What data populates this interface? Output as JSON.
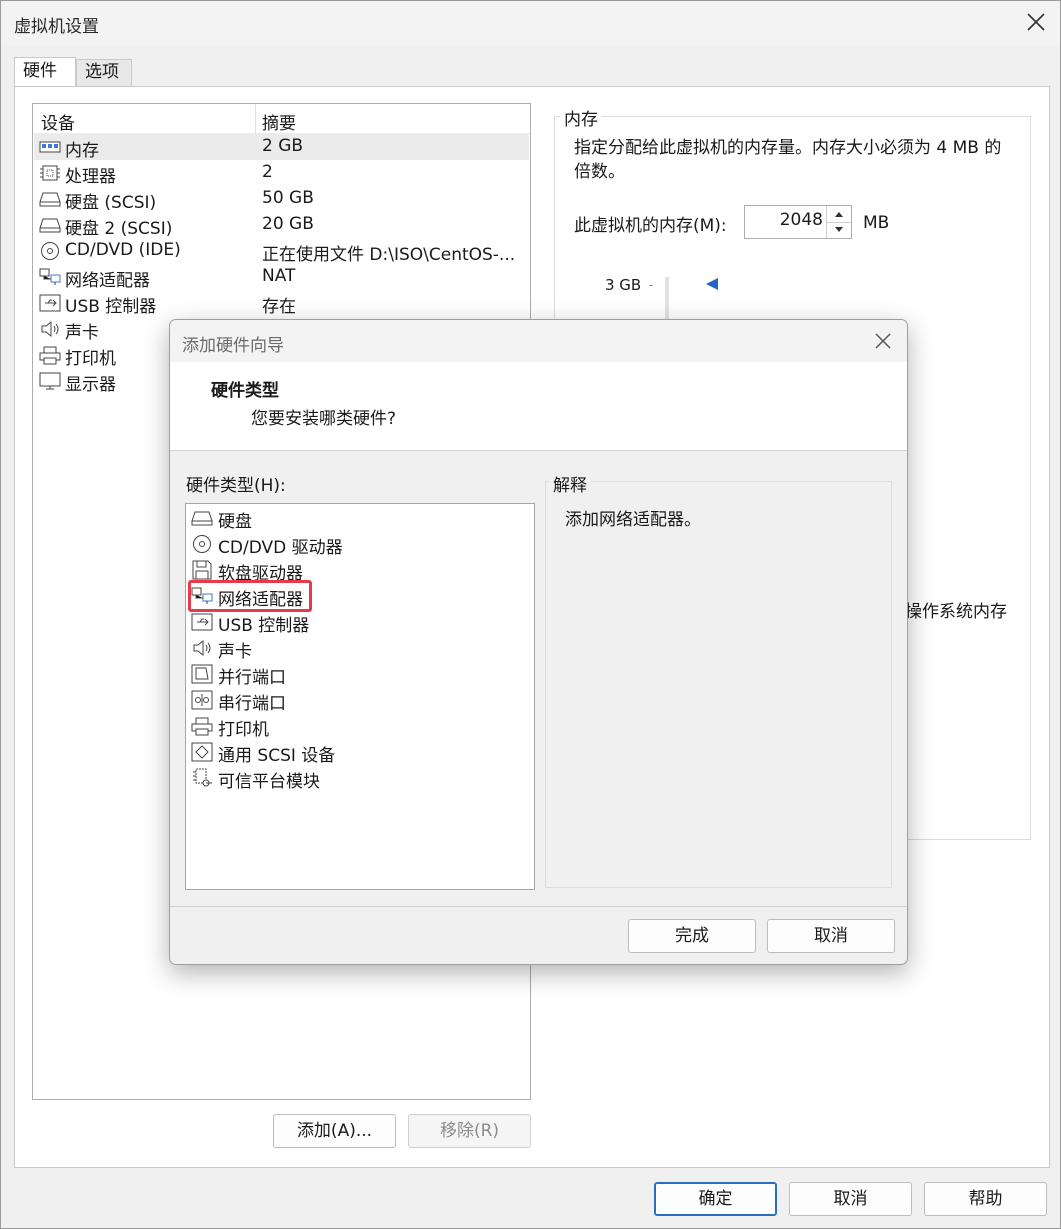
{
  "window": {
    "title": "虚拟机设置",
    "tabs": [
      {
        "label": "硬件"
      },
      {
        "label": "选项"
      }
    ],
    "device_list": {
      "columns": [
        "设备",
        "摘要"
      ],
      "rows": [
        {
          "name": "内存",
          "summary": "2 GB",
          "icon": "memory-icon"
        },
        {
          "name": "处理器",
          "summary": "2",
          "icon": "processor-icon"
        },
        {
          "name": "硬盘 (SCSI)",
          "summary": "50 GB",
          "icon": "hard-disk-icon"
        },
        {
          "name": "硬盘 2 (SCSI)",
          "summary": "20 GB",
          "icon": "hard-disk-icon"
        },
        {
          "name": "CD/DVD (IDE)",
          "summary": "正在使用文件 D:\\ISO\\CentOS-...",
          "icon": "cd-dvd-icon"
        },
        {
          "name": "网络适配器",
          "summary": "NAT",
          "icon": "network-adapter-icon"
        },
        {
          "name": "USB 控制器",
          "summary": "存在",
          "icon": "usb-icon"
        },
        {
          "name": "声卡",
          "summary": "",
          "icon": "speaker-icon"
        },
        {
          "name": "打印机",
          "summary": "",
          "icon": "printer-icon"
        },
        {
          "name": "显示器",
          "summary": "",
          "icon": "monitor-icon"
        }
      ],
      "selected": "内存"
    },
    "add_button": "添加(A)...",
    "remove_button": "移除(R)",
    "memory": {
      "group_label": "内存",
      "description": "指定分配给此虚拟机的内存量。内存大小必须为 4 MB 的倍数。",
      "field_label": "此虚拟机的内存(M):",
      "value": "2048",
      "unit": "MB",
      "tick_label": "3 GB",
      "clipped_text": "操作系统内存"
    },
    "ok_button": "确定",
    "cancel_button": "取消",
    "help_button": "帮助"
  },
  "wizard": {
    "title": "添加硬件向导",
    "header_title": "硬件类型",
    "header_subtitle": "您要安装哪类硬件?",
    "list_label": "硬件类型(H):",
    "hardware_types": [
      {
        "label": "硬盘",
        "icon": "hard-disk-icon"
      },
      {
        "label": "CD/DVD 驱动器",
        "icon": "cd-dvd-icon"
      },
      {
        "label": "软盘驱动器",
        "icon": "floppy-icon"
      },
      {
        "label": "网络适配器",
        "icon": "network-adapter-icon"
      },
      {
        "label": "USB 控制器",
        "icon": "usb-icon"
      },
      {
        "label": "声卡",
        "icon": "speaker-icon"
      },
      {
        "label": "并行端口",
        "icon": "parallel-port-icon"
      },
      {
        "label": "串行端口",
        "icon": "serial-port-icon"
      },
      {
        "label": "打印机",
        "icon": "printer-icon"
      },
      {
        "label": "通用 SCSI 设备",
        "icon": "scsi-icon"
      },
      {
        "label": "可信平台模块",
        "icon": "tpm-icon"
      }
    ],
    "selected_type": "网络适配器",
    "highlight_color": "#e53b4a",
    "explanation_label": "解释",
    "explanation_text": "添加网络适配器。",
    "finish_button": "完成",
    "cancel_button": "取消"
  },
  "colors": {
    "accent": "#2a6fbf",
    "slider_thumb": "#1f66c2"
  }
}
